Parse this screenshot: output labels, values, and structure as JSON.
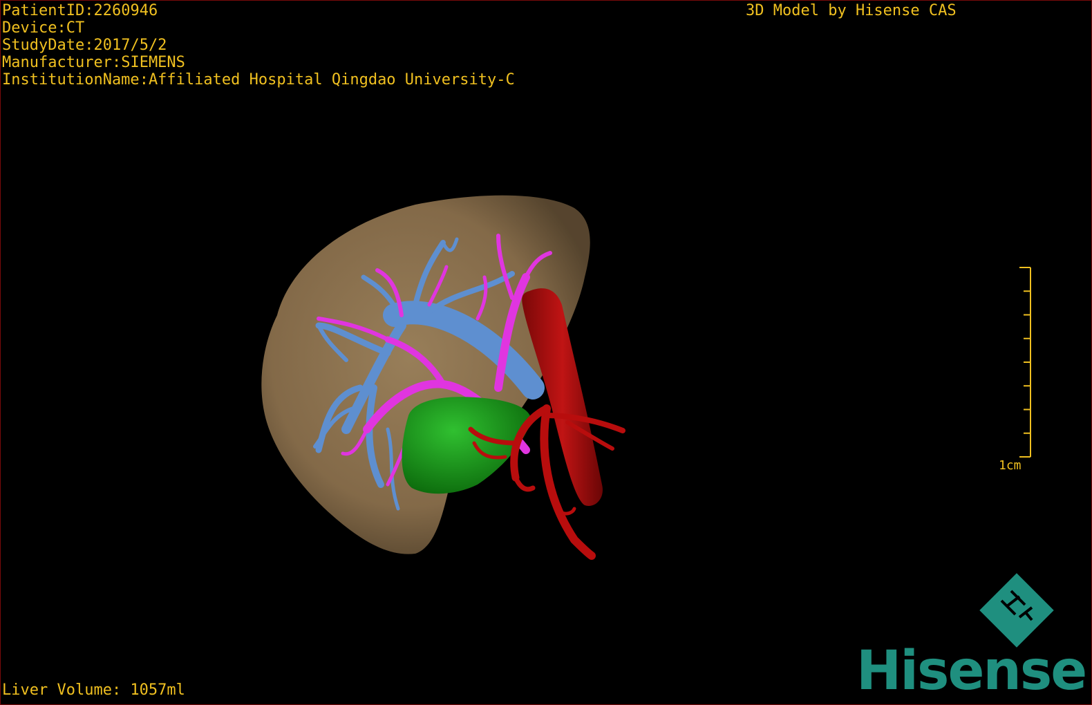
{
  "app": "3D liver model viewer",
  "header": {
    "brand_line": "3D Model by Hisense CAS"
  },
  "patient_info": [
    {
      "label": "PatientID",
      "value": "2260946"
    },
    {
      "label": "Device",
      "value": "CT"
    },
    {
      "label": "StudyDate",
      "value": "2017/5/2"
    },
    {
      "label": "Manufacturer",
      "value": "SIEMENS"
    },
    {
      "label": "InstitutionName",
      "value": "Affiliated Hospital Qingdao University-C"
    }
  ],
  "footer": {
    "liver_volume": "Liver Volume: 1057ml"
  },
  "scale": {
    "label": "1cm",
    "color": "#f0c020"
  },
  "logo": {
    "word": "Hisense",
    "mark": "H"
  },
  "structure_colors": {
    "liver": "#8d7350",
    "portal_vein": "#5e8fd0",
    "hepatic_artery": "#e035e0",
    "gallbladder": "#1fa01f",
    "inferior_vena_cava_aorta": "#b80d0d",
    "logo": "#1f8f7f",
    "text": "#f0c020"
  }
}
